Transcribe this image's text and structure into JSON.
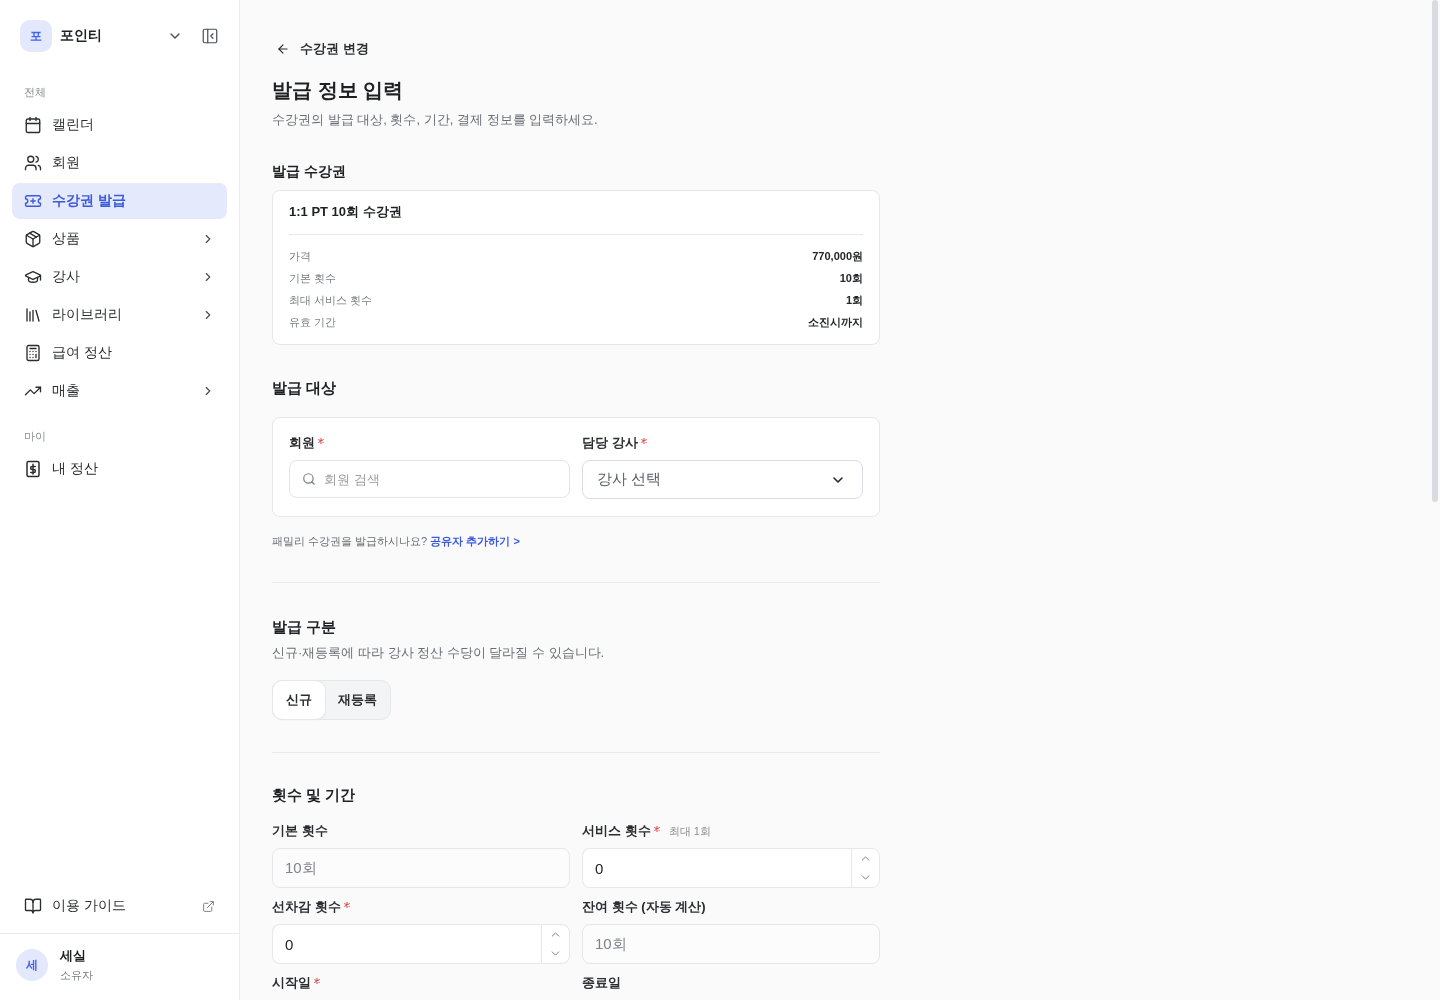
{
  "sidebar": {
    "workspace": {
      "initial": "포",
      "name": "포인티"
    },
    "groups": [
      {
        "label": "전체",
        "items": [
          {
            "label": "캘린더",
            "selected": false,
            "has_submenu": false
          },
          {
            "label": "회원",
            "selected": false,
            "has_submenu": false
          },
          {
            "label": "수강권 발급",
            "selected": true,
            "has_submenu": false
          },
          {
            "label": "상품",
            "selected": false,
            "has_submenu": true
          },
          {
            "label": "강사",
            "selected": false,
            "has_submenu": true
          },
          {
            "label": "라이브러리",
            "selected": false,
            "has_submenu": true
          },
          {
            "label": "급여 정산",
            "selected": false,
            "has_submenu": false
          },
          {
            "label": "매출",
            "selected": false,
            "has_submenu": true
          }
        ]
      },
      {
        "label": "마이",
        "items": [
          {
            "label": "내 정산",
            "selected": false,
            "has_submenu": false
          }
        ]
      }
    ],
    "guide": {
      "label": "이용 가이드"
    },
    "user": {
      "initial": "세",
      "name": "세실",
      "role": "소유자"
    }
  },
  "header": {
    "back_label": "수강권 변경",
    "title": "발급 정보 입력",
    "description": "수강권의 발급 대상, 횟수, 기간, 결제 정보를 입력하세요."
  },
  "ticket_section": {
    "heading": "발급 수강권",
    "ticket": {
      "name": "1:1 PT 10회 수강권",
      "details": [
        {
          "label": "가격",
          "value": "770,000원"
        },
        {
          "label": "기본 횟수",
          "value": "10회"
        },
        {
          "label": "최대 서비스 횟수",
          "value": "1회"
        },
        {
          "label": "유효 기간",
          "value": "소진시까지"
        }
      ]
    }
  },
  "target_section": {
    "heading": "발급 대상",
    "fields": [
      {
        "kind": "search",
        "label": "회원",
        "required": true,
        "placeholder": "회원 검색"
      },
      {
        "kind": "select",
        "label": "담당 강사",
        "required": true,
        "placeholder": "강사 선택"
      }
    ],
    "family_note": {
      "text": "패밀리 수강권을 발급하시나요?",
      "link": "공유자 추가하기 >"
    }
  },
  "type_section": {
    "heading": "발급 구분",
    "description": "신규·재등록에 따라 강사 정산 수당이 달라질 수 있습니다.",
    "options": [
      {
        "label": "신규",
        "selected": true
      },
      {
        "label": "재등록",
        "selected": false
      }
    ]
  },
  "count_section": {
    "heading": "횟수 및 기간",
    "fields": [
      {
        "kind": "readonly",
        "label": "기본 횟수",
        "required": false,
        "value": "10회"
      },
      {
        "kind": "stepper",
        "label": "서비스 횟수",
        "required": true,
        "hint": "최대 1회",
        "value": "0"
      },
      {
        "kind": "stepper",
        "label": "선차감 횟수",
        "required": true,
        "value": "0"
      },
      {
        "kind": "readonly",
        "label": "잔여 횟수 (자동 계산)",
        "required": false,
        "value": "10회"
      },
      {
        "kind": "date",
        "label": "시작일",
        "required": true
      },
      {
        "kind": "date",
        "label": "종료일",
        "required": false
      }
    ]
  }
}
